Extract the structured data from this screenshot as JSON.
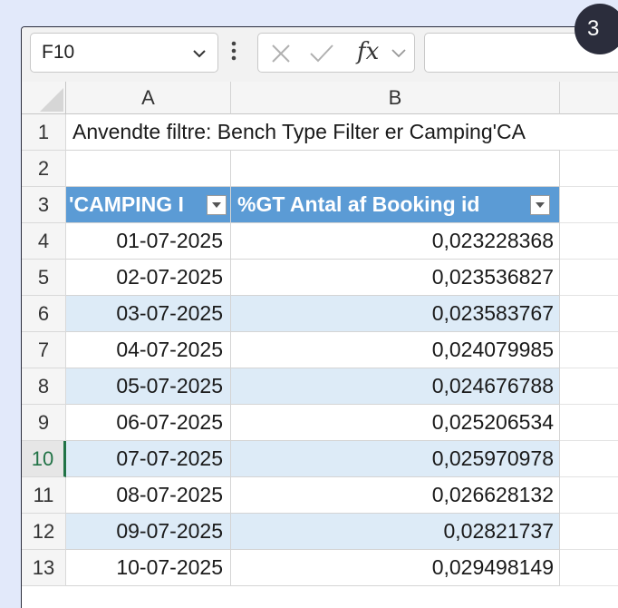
{
  "badge": "3",
  "namebox": {
    "value": "F10"
  },
  "formula": {
    "fx_label": "fx",
    "value": ""
  },
  "columns": [
    "A",
    "B"
  ],
  "rows": [
    {
      "num": "1",
      "a": "Anvendte filtre: Bench Type Filter er Camping'CA",
      "b": ""
    },
    {
      "num": "2",
      "a": "",
      "b": ""
    },
    {
      "num": "3",
      "a": "'CAMPING I",
      "b": "%GT Antal af Booking id"
    },
    {
      "num": "4",
      "a": "01-07-2025",
      "b": "0,023228368"
    },
    {
      "num": "5",
      "a": "02-07-2025",
      "b": "0,023536827"
    },
    {
      "num": "6",
      "a": "03-07-2025",
      "b": "0,023583767"
    },
    {
      "num": "7",
      "a": "04-07-2025",
      "b": "0,024079985"
    },
    {
      "num": "8",
      "a": "05-07-2025",
      "b": "0,024676788"
    },
    {
      "num": "9",
      "a": "06-07-2025",
      "b": "0,025206534"
    },
    {
      "num": "10",
      "a": "07-07-2025",
      "b": "0,025970978"
    },
    {
      "num": "11",
      "a": "08-07-2025",
      "b": "0,026628132"
    },
    {
      "num": "12",
      "a": "09-07-2025",
      "b": "0,02821737"
    },
    {
      "num": "13",
      "a": "10-07-2025",
      "b": "0,029498149"
    }
  ],
  "active_row": "10",
  "colors": {
    "header_fill": "#5b9bd5",
    "band_fill": "#ddebf7",
    "active_green": "#217346"
  }
}
